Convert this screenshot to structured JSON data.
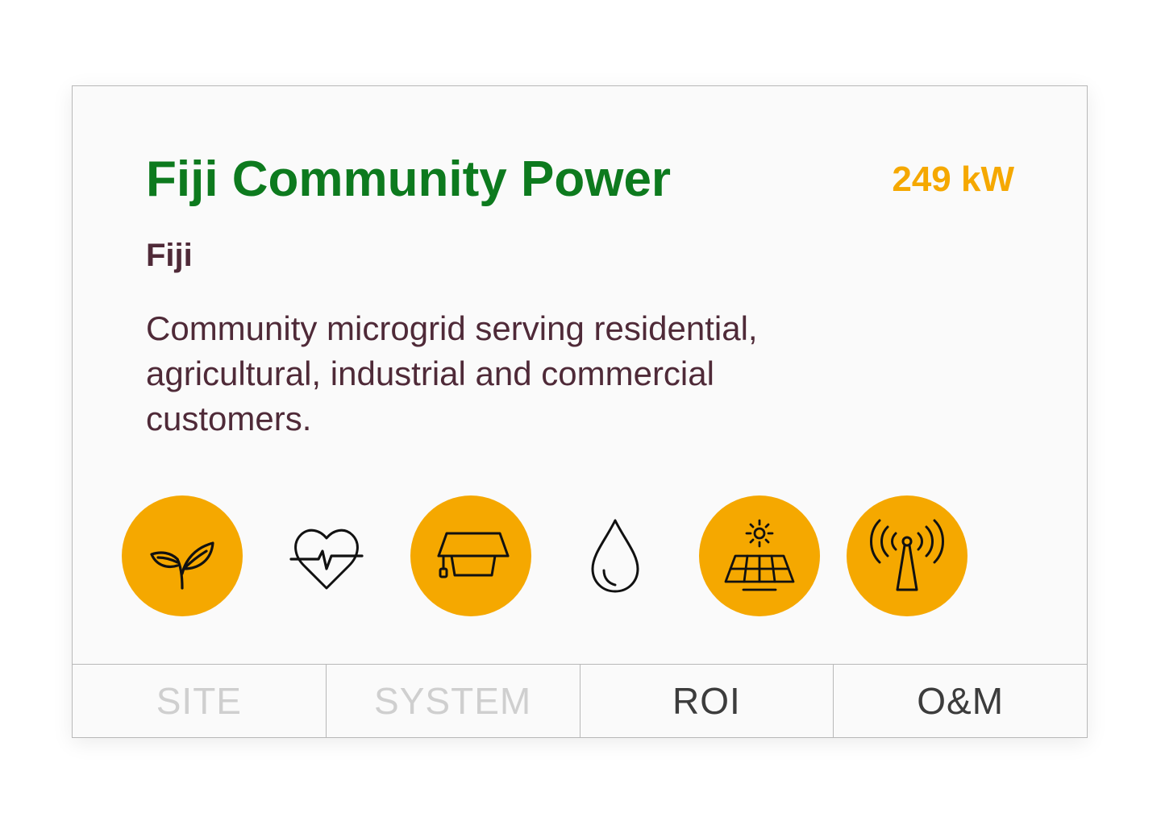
{
  "project": {
    "title": "Fiji Community Power",
    "capacity": "249 kW",
    "country": "Fiji",
    "description": "Community microgrid serving residential, agricultural, industrial and commercial customers."
  },
  "colors": {
    "title": "#0d7a1e",
    "capacity": "#f5a800",
    "text": "#4f2a38",
    "icon_active_bg": "#f5a800"
  },
  "icons": [
    {
      "name": "agriculture-icon",
      "active": true
    },
    {
      "name": "health-icon",
      "active": false
    },
    {
      "name": "education-icon",
      "active": true
    },
    {
      "name": "water-icon",
      "active": false
    },
    {
      "name": "solar-icon",
      "active": true
    },
    {
      "name": "telecom-icon",
      "active": true
    }
  ],
  "tabs": [
    {
      "label": "SITE",
      "enabled": false
    },
    {
      "label": "SYSTEM",
      "enabled": false
    },
    {
      "label": "ROI",
      "enabled": true
    },
    {
      "label": "O&M",
      "enabled": true
    }
  ]
}
